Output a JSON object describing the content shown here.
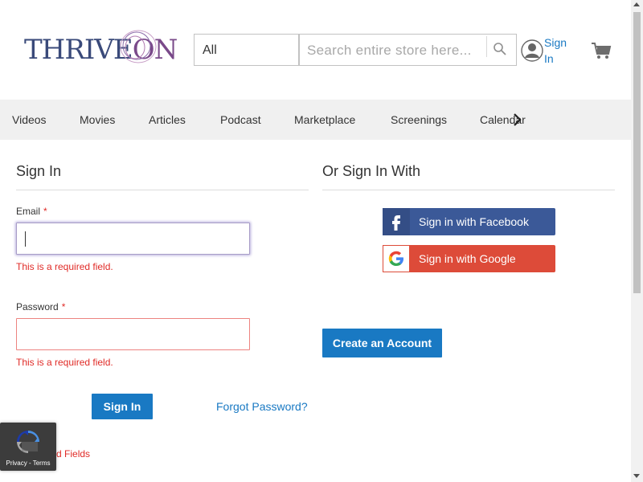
{
  "header": {
    "logo_text_a": "THRIVE",
    "logo_text_b": "ON",
    "category_select_value": "All",
    "search_placeholder": "Search entire store here...",
    "signin_label": "Sign In"
  },
  "nav": {
    "items": [
      "Videos",
      "Movies",
      "Articles",
      "Podcast",
      "Marketplace",
      "Screenings",
      "Calendar"
    ]
  },
  "signin": {
    "title": "Sign In",
    "email_label": "Email",
    "password_label": "Password",
    "required_star": "*",
    "email_error": "This is a required field.",
    "password_error": "This is a required field.",
    "submit_label": "Sign In",
    "forgot_label": "Forgot Password?",
    "required_fields_note": "* Required Fields"
  },
  "social": {
    "title": "Or Sign In With",
    "facebook_label": "Sign in with Facebook",
    "google_label": "Sign in with Google",
    "create_account_label": "Create an Account"
  },
  "recaptcha": {
    "text": "Privacy - Terms"
  },
  "colors": {
    "accent": "#1979c3",
    "error": "#e02b27",
    "facebook": "#3b5998",
    "google": "#dd4b39",
    "nav_bg": "#f0f0f0"
  }
}
